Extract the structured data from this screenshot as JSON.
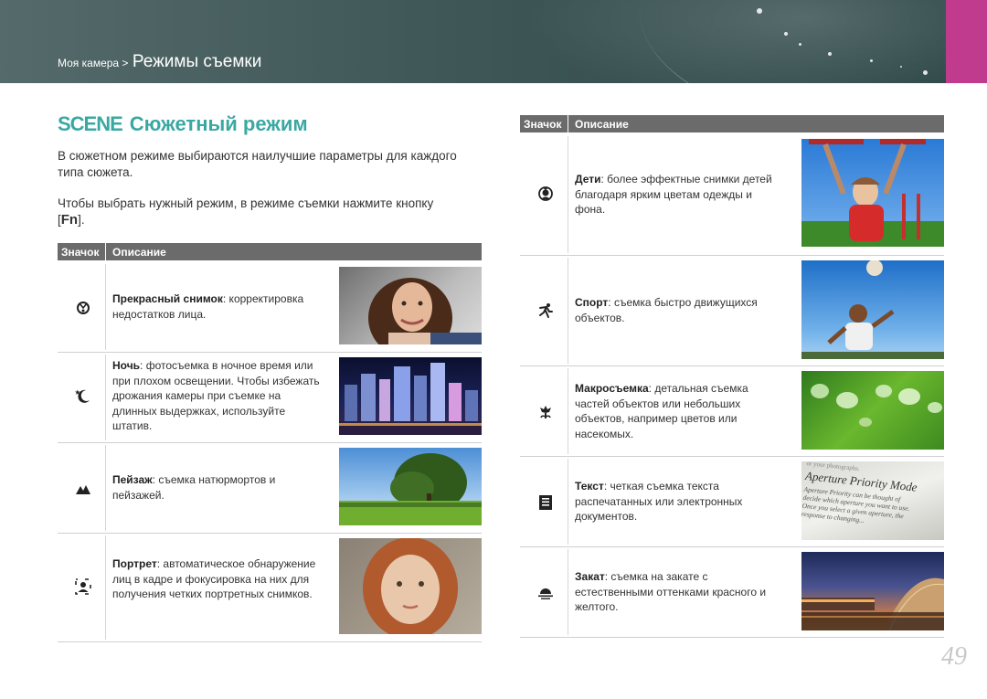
{
  "header": {
    "breadcrumb_parent": "Моя камера >",
    "breadcrumb_current": "Режимы съемки"
  },
  "title": {
    "scene_label": "SCENE",
    "text": "Сюжетный режим"
  },
  "intro": {
    "p1": "В сюжетном режиме выбираются наилучшие параметры для каждого типа сюжета.",
    "p2_before": "Чтобы выбрать нужный режим, в режиме съемки нажмите кнопку [",
    "p2_key": "Fn",
    "p2_after": "]."
  },
  "table_header": {
    "col_icon": "Значок",
    "col_desc": "Описание"
  },
  "left_rows": [
    {
      "icon": "beauty-shot-icon",
      "glyph": "☺",
      "name": "Прекрасный снимок",
      "sep": ":",
      "text": " корректировка недостатков лица."
    },
    {
      "icon": "night-icon",
      "glyph": "☾",
      "name": "Ночь",
      "sep": ":",
      "text": " фотосъемка в ночное время или при плохом освещении. Чтобы избежать дрожания камеры при съемке на длинных выдержках, используйте штатив."
    },
    {
      "icon": "landscape-icon",
      "glyph": "▲",
      "name": "Пейзаж",
      "sep": ":",
      "text": " съемка натюрмортов и пейзажей."
    },
    {
      "icon": "portrait-icon",
      "glyph": "◙",
      "name": "Портрет",
      "sep": ":",
      "text": " автоматическое обнаружение лиц в кадре и фокусировка на них для получения четких портретных снимков."
    }
  ],
  "right_rows": [
    {
      "icon": "children-icon",
      "glyph": "☻",
      "name": "Дети",
      "sep": ":",
      "text": " более эффектные снимки детей благодаря ярким цветам одежды и фона."
    },
    {
      "icon": "sports-icon",
      "glyph": "✈",
      "name": "Спорт",
      "sep": ":",
      "text": " съемка быстро движущихся объектов."
    },
    {
      "icon": "macro-icon",
      "glyph": "✿",
      "name": "Макросъемка",
      "sep": ":",
      "text": " детальная съемка частей объектов или небольших объектов, например цветов или насекомых."
    },
    {
      "icon": "text-icon",
      "glyph": "▤",
      "name": "Текст",
      "sep": ":",
      "text": " четкая съемка текста распечатанных или электронных документов."
    },
    {
      "icon": "sunset-icon",
      "glyph": "◓",
      "name": "Закат",
      "sep": ":",
      "text": " съемка на закате с естественными оттенками красного и желтого."
    }
  ],
  "photo_text": {
    "line1": "or your photographs.",
    "line2": "Aperture Priority Mode",
    "line3": "Aperture Priority can be thought of",
    "line4": "decide which aperture you want to use.",
    "line5": "Once you select a given aperture, the",
    "line6": "response to changing..."
  },
  "page_number": "49"
}
